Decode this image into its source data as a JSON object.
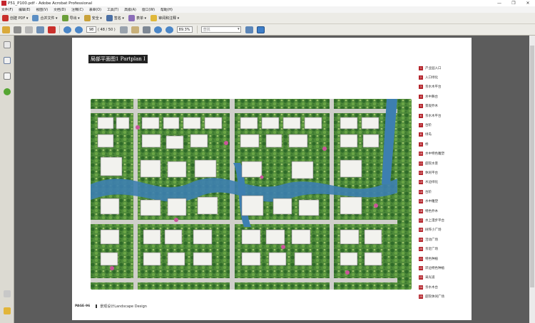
{
  "window": {
    "title": "P51_P100.pdf - Adobe Acrobat Professional",
    "minimize": "—",
    "restore": "❐",
    "close": "✕"
  },
  "menu": [
    "文件(F)",
    "编辑(E)",
    "视图(V)",
    "文档(D)",
    "注释(C)",
    "表单(O)",
    "工具(T)",
    "高级(A)",
    "窗口(W)",
    "帮助(H)"
  ],
  "toolbar1": {
    "create_pdf": "创建 PDF",
    "combine": "合并文件",
    "export": "导出",
    "security": "安全",
    "sign": "签名",
    "forms": "表单",
    "review": "审阅和注释"
  },
  "toolbar2": {
    "page_current": "98",
    "page_total": "( 48 / 50 )",
    "zoom": "89.3%",
    "find_placeholder": "查找"
  },
  "page": {
    "title": "局部平面图1 Partplan Ⅰ",
    "footer_page": "PAGE-96",
    "footer_caption": "景观设计Landscape Design"
  },
  "legend": [
    {
      "num": "1",
      "label": "产业园入口"
    },
    {
      "num": "2",
      "label": "入口绿化"
    },
    {
      "num": "3",
      "label": "亲水木平台"
    },
    {
      "num": "4",
      "label": "水中舞台"
    },
    {
      "num": "5",
      "label": "景观乔木"
    },
    {
      "num": "6",
      "label": "亲水木平台"
    },
    {
      "num": "7",
      "label": "台阶"
    },
    {
      "num": "8",
      "label": "绿岛"
    },
    {
      "num": "9",
      "label": "桥"
    },
    {
      "num": "10",
      "label": "水中特色雕塑"
    },
    {
      "num": "11",
      "label": "庭院水景"
    },
    {
      "num": "12",
      "label": "休闲平台"
    },
    {
      "num": "13",
      "label": "水边绿化"
    },
    {
      "num": "14",
      "label": "台阶"
    },
    {
      "num": "15",
      "label": "水中雕塑"
    },
    {
      "num": "16",
      "label": "特色乔木"
    },
    {
      "num": "17",
      "label": "水上漫步平台"
    },
    {
      "num": "18",
      "label": "树阵小广场"
    },
    {
      "num": "19",
      "label": "活动广场"
    },
    {
      "num": "20",
      "label": "亲近广场"
    },
    {
      "num": "21",
      "label": "特色种植"
    },
    {
      "num": "22",
      "label": "岸边特色种植"
    },
    {
      "num": "23",
      "label": "采光道"
    },
    {
      "num": "24",
      "label": "亲水木台"
    },
    {
      "num": "25",
      "label": "庭院休闲广场"
    }
  ],
  "colors": {
    "legend_badge": "#b5262d",
    "water": "#3d7fb0",
    "greenery": "#3f7a33",
    "path": "#c9c9c4"
  },
  "icons": {
    "nav_pages": "pages-icon",
    "nav_attachments": "attachments-icon",
    "nav_signatures": "signatures-icon",
    "nav_help": "help-icon"
  }
}
